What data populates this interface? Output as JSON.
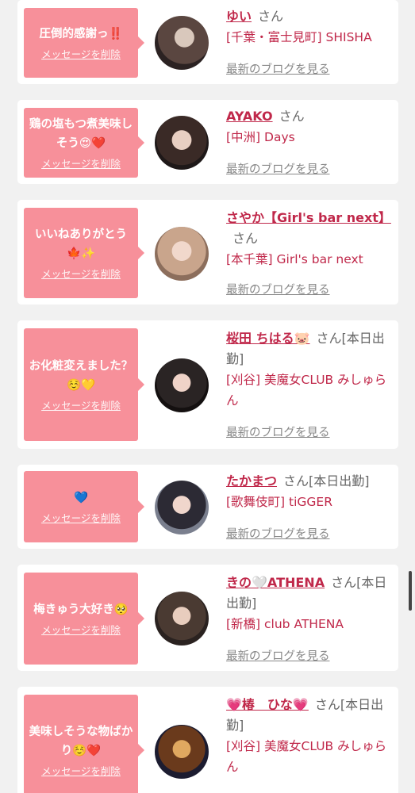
{
  "colors": {
    "bubble": "#f7909a",
    "name": "#c0284a",
    "card": "#ffffff",
    "page": "#f1f1f1"
  },
  "cards": [
    {
      "message": "圧倒的感謝っ‼️",
      "delete_label": "メッセージを削除",
      "name": "ゆい",
      "san": "さん",
      "shop": "[千葉・富士見町] SHISHA",
      "blog": "最新のブログを見る"
    },
    {
      "message": "鶏の塩もつ煮美味しそう😍❤️",
      "delete_label": "メッセージを削除",
      "name": "AYAKO",
      "san": "さん",
      "shop": "[中洲] Days",
      "blog": "最新のブログを見る"
    },
    {
      "message": "いいねありがとう🍁✨",
      "delete_label": "メッセージを削除",
      "name": "さやか【Girl's bar next】",
      "san": "さん",
      "shop": "[本千葉] Girl's bar next",
      "blog": "最新のブログを見る"
    },
    {
      "message": "お化粧変えました？☺️💛",
      "delete_label": "メッセージを削除",
      "name": "桜田 ちはる🐷",
      "san": "さん[本日出勤]",
      "shop": "[刈谷] 美魔女CLUB みしゅらん",
      "blog": "最新のブログを見る"
    },
    {
      "message": "💙",
      "delete_label": "メッセージを削除",
      "name": "たかまつ",
      "san": "さん[本日出勤]",
      "shop": "[歌舞伎町] tiGGER",
      "blog": "最新のブログを見る"
    },
    {
      "message": "梅きゅう大好き🥺",
      "delete_label": "メッセージを削除",
      "name": "きの🤍ATHENA",
      "san": "さん[本日出勤]",
      "shop": "[新橋] club ATHENA",
      "blog": "最新のブログを見る"
    },
    {
      "message": "美味しそうな物ばかり☺️❤️",
      "delete_label": "メッセージを削除",
      "name": "💗椿　ひな💗",
      "san": "さん[本日出勤]",
      "shop": "[刈谷] 美魔女CLUB みしゅらん",
      "blog": ""
    }
  ]
}
